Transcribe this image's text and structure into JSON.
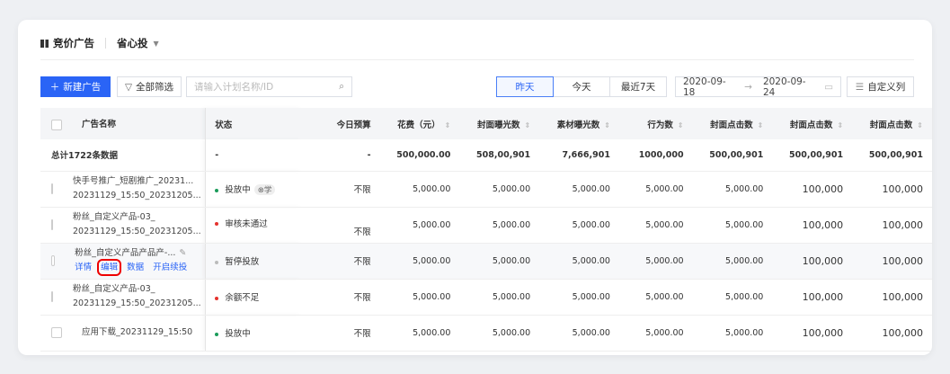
{
  "header": {
    "title": "竞价广告",
    "product": "省心投"
  },
  "toolbar": {
    "new_label": "新建广告",
    "filter_label": "全部筛选",
    "search_placeholder": "请输入计划名称/ID",
    "periods": [
      "昨天",
      "今天",
      "最近7天"
    ],
    "active_period": "昨天",
    "date_start": "2020-09-18",
    "date_end": "2020-09-24",
    "custom_cols_label": "自定义列"
  },
  "table": {
    "columns": [
      "广告名称",
      "状态",
      "今日预算",
      "花费（元）",
      "封面曝光数",
      "素材曝光数",
      "行为数",
      "封面点击数",
      "封面点击数",
      "封面点击数"
    ],
    "total": {
      "label": "总计1722条数据",
      "status": "-",
      "budget": "-",
      "values": [
        "500,000.00",
        "508,00,901",
        "7,666,901",
        "1000,000",
        "500,00,901",
        "500,00,901",
        "500,00,901"
      ]
    },
    "rows": [
      {
        "name1": "快手号推广_短剧推广_20231...",
        "name2": "20231129_15:50_20231205...",
        "status": "投放中",
        "status_color": "#1a9b5a",
        "tag": "学",
        "budget": "不限",
        "values": [
          "5,000.00",
          "5,000.00",
          "5,000.00",
          "5,000.00",
          "5,000.00",
          "100,000",
          "100,000"
        ]
      },
      {
        "name1": "粉丝_自定义产品-03_",
        "name2": "20231129_15:50_20231205...",
        "status": "审核未通过",
        "status_color": "#e5322d",
        "budget": "不限",
        "values": [
          "5,000.00",
          "5,000.00",
          "5,000.00",
          "5,000.00",
          "5,000.00",
          "100,000",
          "100,000"
        ]
      },
      {
        "name1": "粉丝_自定义产品产品产-...",
        "actions": [
          "详情",
          "编辑",
          "数据",
          "开启续投"
        ],
        "status": "暂停投放",
        "status_color": "#bbbbbb",
        "budget": "不限",
        "values": [
          "5,000.00",
          "5,000.00",
          "5,000.00",
          "5,000.00",
          "5,000.00",
          "100,000",
          "100,000"
        ]
      },
      {
        "name1": "粉丝_自定义产品-03_",
        "name2": "20231129_15:50_20231205...",
        "status": "余额不足",
        "status_color": "#e5322d",
        "budget": "不限",
        "values": [
          "5,000.00",
          "5,000.00",
          "5,000.00",
          "5,000.00",
          "5,000.00",
          "100,000",
          "100,000"
        ]
      },
      {
        "name1": "应用下载_20231129_15:50",
        "status": "投放中",
        "status_color": "#1a9b5a",
        "budget": "不限",
        "values": [
          "5,000.00",
          "5,000.00",
          "5,000.00",
          "5,000.00",
          "5,000.00",
          "100,000",
          "100,000"
        ]
      }
    ]
  }
}
